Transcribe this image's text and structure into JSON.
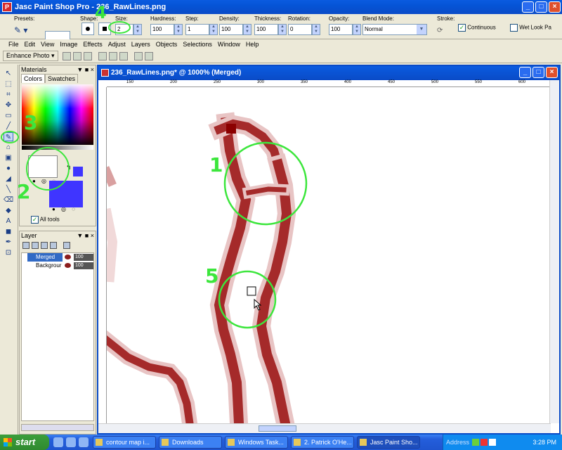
{
  "window": {
    "title": "Jasc Paint Shop Pro - 236_RawLines.png",
    "min": "_",
    "max": "□",
    "close": "×"
  },
  "options": {
    "presets_label": "Presets:",
    "shape_label": "Shape:",
    "size_label": "Size:",
    "size_value": "2",
    "hardness_label": "Hardness:",
    "hardness_value": "100",
    "step_label": "Step:",
    "step_value": "1",
    "density_label": "Density:",
    "density_value": "100",
    "thickness_label": "Thickness:",
    "thickness_value": "100",
    "rotation_label": "Rotation:",
    "rotation_value": "0",
    "opacity_label": "Opacity:",
    "opacity_value": "100",
    "blend_label": "Blend Mode:",
    "blend_value": "Normal",
    "stroke_label": "Stroke:",
    "continuous_label": "Continuous",
    "wetlook_label": "Wet Look Pa"
  },
  "menu": [
    "File",
    "Edit",
    "View",
    "Image",
    "Effects",
    "Adjust",
    "Layers",
    "Objects",
    "Selections",
    "Window",
    "Help"
  ],
  "toolbar": {
    "enhance_label": "Enhance Photo ▾"
  },
  "materials": {
    "title": "Materials",
    "tab_colors": "Colors",
    "tab_swatches": "Swatches",
    "alltools_label": "All tools",
    "fg_color": "#ffffff",
    "bg_color": "#3f35ff"
  },
  "layers": {
    "title": "Layer",
    "rows": [
      {
        "name": "Merged",
        "opacity": "100"
      },
      {
        "name": "Backgrour",
        "opacity": "100"
      }
    ]
  },
  "image_window": {
    "title": "236_RawLines.png* @ 1000% (Merged)",
    "ruler_ticks": [
      "150",
      "200",
      "250",
      "300",
      "350",
      "400",
      "450",
      "500",
      "550",
      "600",
      "650"
    ]
  },
  "annotations": [
    "1",
    "2",
    "3",
    "4",
    "5"
  ],
  "taskbar": {
    "start_label": "start",
    "tasks": [
      "contour map i...",
      "Downloads",
      "Windows Task...",
      "2. Patrick O'He...",
      "Jasc Paint Sho..."
    ],
    "address_label": "Address",
    "clock": "3:28 PM"
  },
  "colors": {
    "stroke": "#a52a2a",
    "annotation": "#3ce63c",
    "title_bar": "#0a4bc7"
  }
}
